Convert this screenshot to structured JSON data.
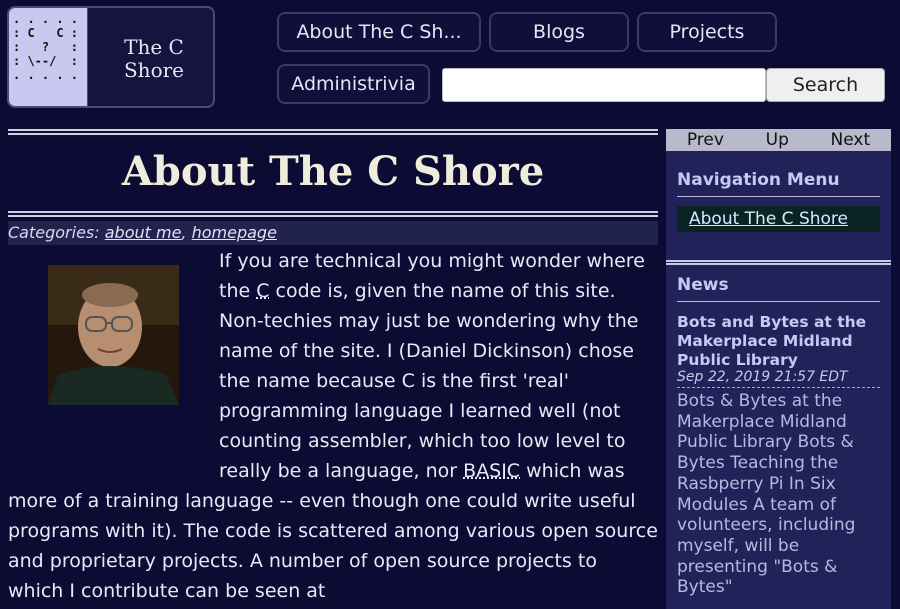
{
  "logo": {
    "title_line1": "The C",
    "title_line2": "Shore",
    "ascii_art": ". . . . .\n: C   C :\n:   ?   :\n: \\--/  :\n. . . . ."
  },
  "nav": {
    "about": "About The C Sh...",
    "blogs": "Blogs",
    "projects": "Projects",
    "administrivia": "Administrivia"
  },
  "search": {
    "value": "",
    "placeholder": "",
    "button_label": "Search"
  },
  "main": {
    "title": "About The C Shore",
    "categories_label": "Categories:",
    "categories": [
      "about me",
      "homepage"
    ],
    "body_parts": {
      "p1": "If you are technical you might wonder where the ",
      "c_abbr": "C",
      "p2": " code is, given the name of this site. Non-techies may just be wondering why the name of the site. I (Daniel Dickinson) chose the name because C is the first 'real' programming language I learned well (not counting assembler, which too low level to really be a language, nor ",
      "basic_abbr": "BASIC",
      "p3": " which was more of a training language -- even though one could write useful programs with it). The code is scattered among various open source and proprietary projects. A number of open source projects to which I contribute can be seen at"
    }
  },
  "sidebar": {
    "pager": {
      "prev": "Prev",
      "up": "Up",
      "next": "Next"
    },
    "nav_heading": "Navigation Menu",
    "menu_items": [
      "About The C Shore"
    ],
    "news_heading": "News",
    "news": {
      "title": "Bots and Bytes at the Makerplace Midland Public Library",
      "date": "Sep 22, 2019 21:57 EDT",
      "body": "Bots & Bytes at the Makerplace Midland Public Library Bots & Bytes Teaching the Rasbperry Pi In Six Modules A team of volunteers, including myself, will be presenting \"Bots & Bytes\""
    }
  },
  "colors": {
    "background": "#0b0b33",
    "sidebar": "#22225a",
    "accent": "#c8c8f4"
  }
}
